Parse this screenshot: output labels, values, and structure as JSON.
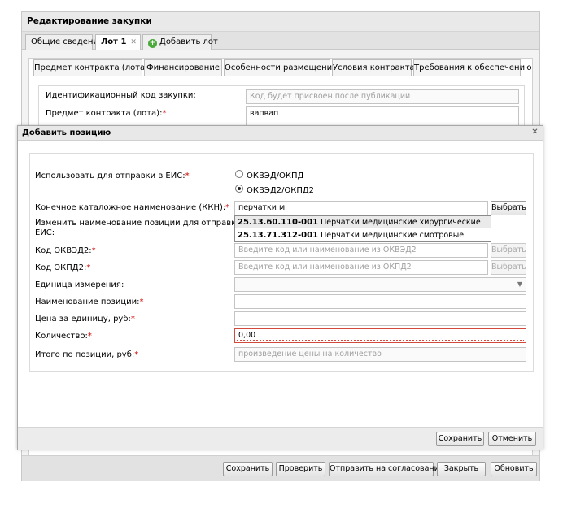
{
  "outer": {
    "title": "Редактирование закупки",
    "tabs": [
      {
        "label": "Общие сведения"
      },
      {
        "label": "Лот 1",
        "close": "✕"
      },
      {
        "label": "Добавить лот"
      }
    ],
    "sub_tabs": [
      "Предмет контракта (лота)",
      "Финансирование",
      "Особенности размещения",
      "Условия контракта",
      "Требования к обеспечению"
    ],
    "form": {
      "id_code_label": "Идентификационный код закупки:",
      "id_code_placeholder": "Код будет присвоен после публикации",
      "subject_label": "Предмет контракта (лота):",
      "subject_value": "вапвап"
    },
    "buttons": {
      "save": "Сохранить",
      "check": "Проверить",
      "send": "Отправить на согласование",
      "close": "Закрыть",
      "refresh": "Обновить"
    }
  },
  "dialog": {
    "title": "Добавить позицию",
    "close_glyph": "✕",
    "use_eis_label": "Использовать для отправки в ЕИС:",
    "radio_options": [
      {
        "label": "ОКВЭД/ОКПД",
        "checked": false
      },
      {
        "label": "ОКВЭД2/ОКПД2",
        "checked": true
      }
    ],
    "kkn_label": "Конечное каталожное наименование (ККН):",
    "kkn_value": "перчатки м",
    "choose_button": "Выбрать",
    "suggestions": [
      {
        "code": "25.13.60.110-001",
        "name": "Перчатки медицинские хирургические"
      },
      {
        "code": "25.13.71.312-001",
        "name": "Перчатки медицинские смотровые"
      }
    ],
    "rename_label_line1": "Изменить наименование позиции для отправки в",
    "rename_label_line2": "ЕИС:",
    "okved2_label": "Код ОКВЭД2:",
    "okved2_placeholder": "Введите код или наименование из ОКВЭД2",
    "okpd2_label": "Код ОКПД2:",
    "okpd2_placeholder": "Введите код или наименование из ОКПД2",
    "unit_label": "Единица измерения:",
    "position_name_label": "Наименование позиции:",
    "price_label": "Цена за единицу, руб:",
    "quantity_label": "Количество:",
    "quantity_value": "0,00",
    "total_label": "Итого по позиции, руб:",
    "total_placeholder": "произведение цены на количество",
    "save_button": "Сохранить",
    "cancel_button": "Отменить"
  },
  "colors": {
    "required": "#cc0000",
    "error_border": "#d24a3c",
    "add_lot_icon": "#4caa3c"
  }
}
